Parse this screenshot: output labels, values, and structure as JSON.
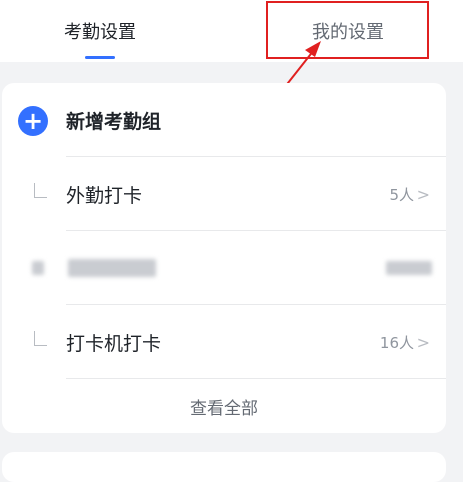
{
  "tabs": {
    "attendance_settings": "考勤设置",
    "my_settings": "我的设置"
  },
  "card": {
    "add_group_label": "新增考勤组",
    "groups": [
      {
        "name": "外勤打卡",
        "count": "5人"
      },
      {
        "name": "",
        "count": ""
      },
      {
        "name": "打卡机打卡",
        "count": "16人"
      }
    ],
    "view_all_label": "查看全部"
  },
  "icons": {
    "add": "plus-circle-icon",
    "chevron": "chevron-right-icon",
    "branch": "tree-branch-icon"
  },
  "colors": {
    "accent": "#3370ff",
    "annotation": "#e02020"
  }
}
